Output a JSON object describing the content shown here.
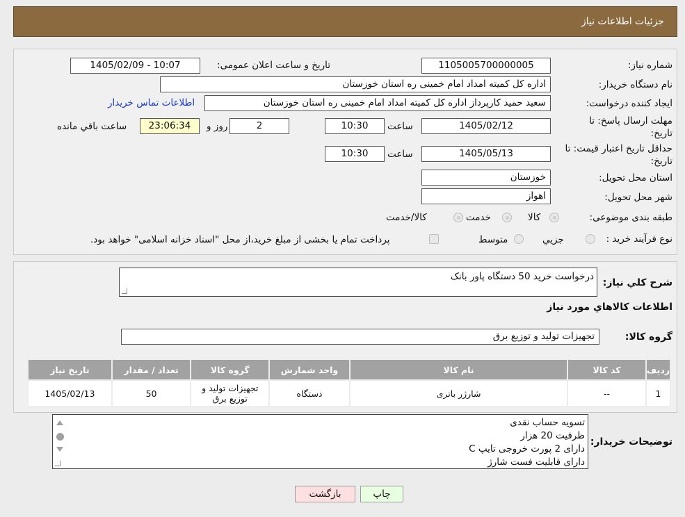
{
  "header": {
    "title": "جزئیات اطلاعات نیاز"
  },
  "form": {
    "need_number_label": "شماره نیاز:",
    "need_number": "1105005700000005",
    "announce_label": "تاریخ و ساعت اعلان عمومی:",
    "announce_value": "1405/02/09 - 10:07",
    "buyer_org_label": "نام دستگاه خریدار:",
    "buyer_org": "اداره کل کمیته امداد امام خمینی  ره  استان خوزستان",
    "requester_label": "ایجاد کننده درخواست:",
    "requester": "سعید حمید کارپرداز اداره کل کمیته امداد امام خمینی  ره  استان خوزستان",
    "contact_link": "اطلاعات تماس خریدار",
    "reply_deadline_label_1": "مهلت ارسال پاسخ: تا",
    "reply_deadline_label_2": "تاریخ:",
    "reply_date": "1405/02/12",
    "time_label": "ساعت",
    "reply_time": "10:30",
    "days_value": "2",
    "days_label": "روز و",
    "remaining_time": "23:06:34",
    "remaining_label": "ساعت باقي مانده",
    "price_validity_label_1": "حداقل تاریخ اعتبار قیمت: تا",
    "price_validity_label_2": "تاریخ:",
    "price_validity_date": "1405/05/13",
    "price_validity_time": "10:30",
    "province_label": "استان محل تحویل:",
    "province": "خوزستان",
    "city_label": "شهر محل تحویل:",
    "city": "اهواز",
    "category_label": "طبقه بندی موضوعی:",
    "category_options": [
      "کالا",
      "خدمت",
      "کالا/خدمت"
    ],
    "process_label": "نوع فرآیند خرید :",
    "process_options": [
      "جزیي",
      "متوسط"
    ],
    "payment_note": "پرداخت تمام یا بخشی از مبلغ خرید،از محل \"اسناد خزانه اسلامی\" خواهد بود."
  },
  "description": {
    "label": "شرح کلي نياز:",
    "value": "درخواست خرید 50 دستگاه پاور بانک"
  },
  "goods": {
    "section_title": "اطلاعات کالاهاي مورد نياز",
    "group_label": "گروه کالا:",
    "group_value": "تجهیزات تولید و توزیع برق",
    "columns": [
      "رديف",
      "کد کالا",
      "نام کالا",
      "واحد شمارش",
      "گروه کالا",
      "تعداد / مقدار",
      "تاریخ نیاز"
    ],
    "rows": [
      [
        "1",
        "--",
        "شارژر باتری",
        "دستگاه",
        "تجهیزات تولید و توزیع برق",
        "50",
        "1405/02/13"
      ]
    ]
  },
  "buyer_notes": {
    "label": "توضيحات خريدار:",
    "lines": [
      "تسویه حساب نقدی",
      "ظرفیت 20 هزار",
      "دارای 2 پورت خروجی تایپ C",
      " دارای قابلیت فست شارژ"
    ]
  },
  "buttons": {
    "print": "چاپ",
    "back": "بازگشت"
  },
  "colors": {
    "header_bg": "#8a6a3e",
    "table_header_bg": "#a2a2a2",
    "back_btn_bg": "#ffe0e0",
    "print_btn_bg": "#e8ffe0",
    "link": "#1a3cc8"
  }
}
